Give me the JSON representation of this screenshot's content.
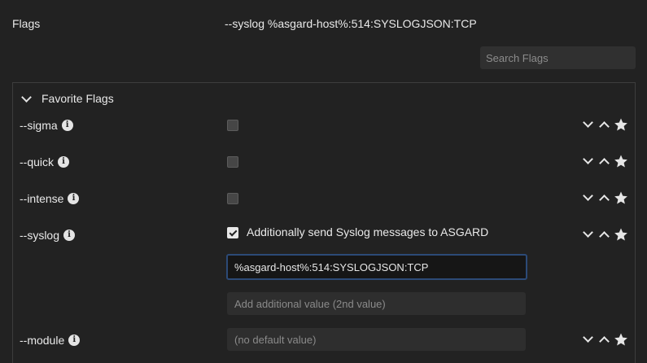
{
  "header": {
    "flags_label": "Flags",
    "command": "--syslog %asgard-host%:514:SYSLOGJSON:TCP",
    "search_placeholder": "Search Flags"
  },
  "section": {
    "title": "Favorite Flags",
    "chevron_icon": "chevron-down-icon"
  },
  "flags": [
    {
      "name": "--sigma",
      "type": "checkbox",
      "checked": false
    },
    {
      "name": "--quick",
      "type": "checkbox",
      "checked": false
    },
    {
      "name": "--intense",
      "type": "checkbox",
      "checked": false
    },
    {
      "name": "--syslog",
      "type": "checkbox",
      "checked": true,
      "checkbox_label": "Additionally send Syslog messages to ASGARD",
      "value": "%asgard-host%:514:SYSLOGJSON:TCP",
      "second_value_placeholder": "Add additional value (2nd value)"
    },
    {
      "name": "--module",
      "type": "text",
      "placeholder": "(no default value)"
    }
  ],
  "icons": {
    "info": "info-icon",
    "move_down": "chevron-down-icon",
    "move_up": "chevron-up-icon",
    "favorite": "star-icon"
  },
  "colors": {
    "background": "#222222",
    "input_bg": "#2e2e2e",
    "focus_border": "#2c4a77",
    "text": "#e9e9e9"
  }
}
